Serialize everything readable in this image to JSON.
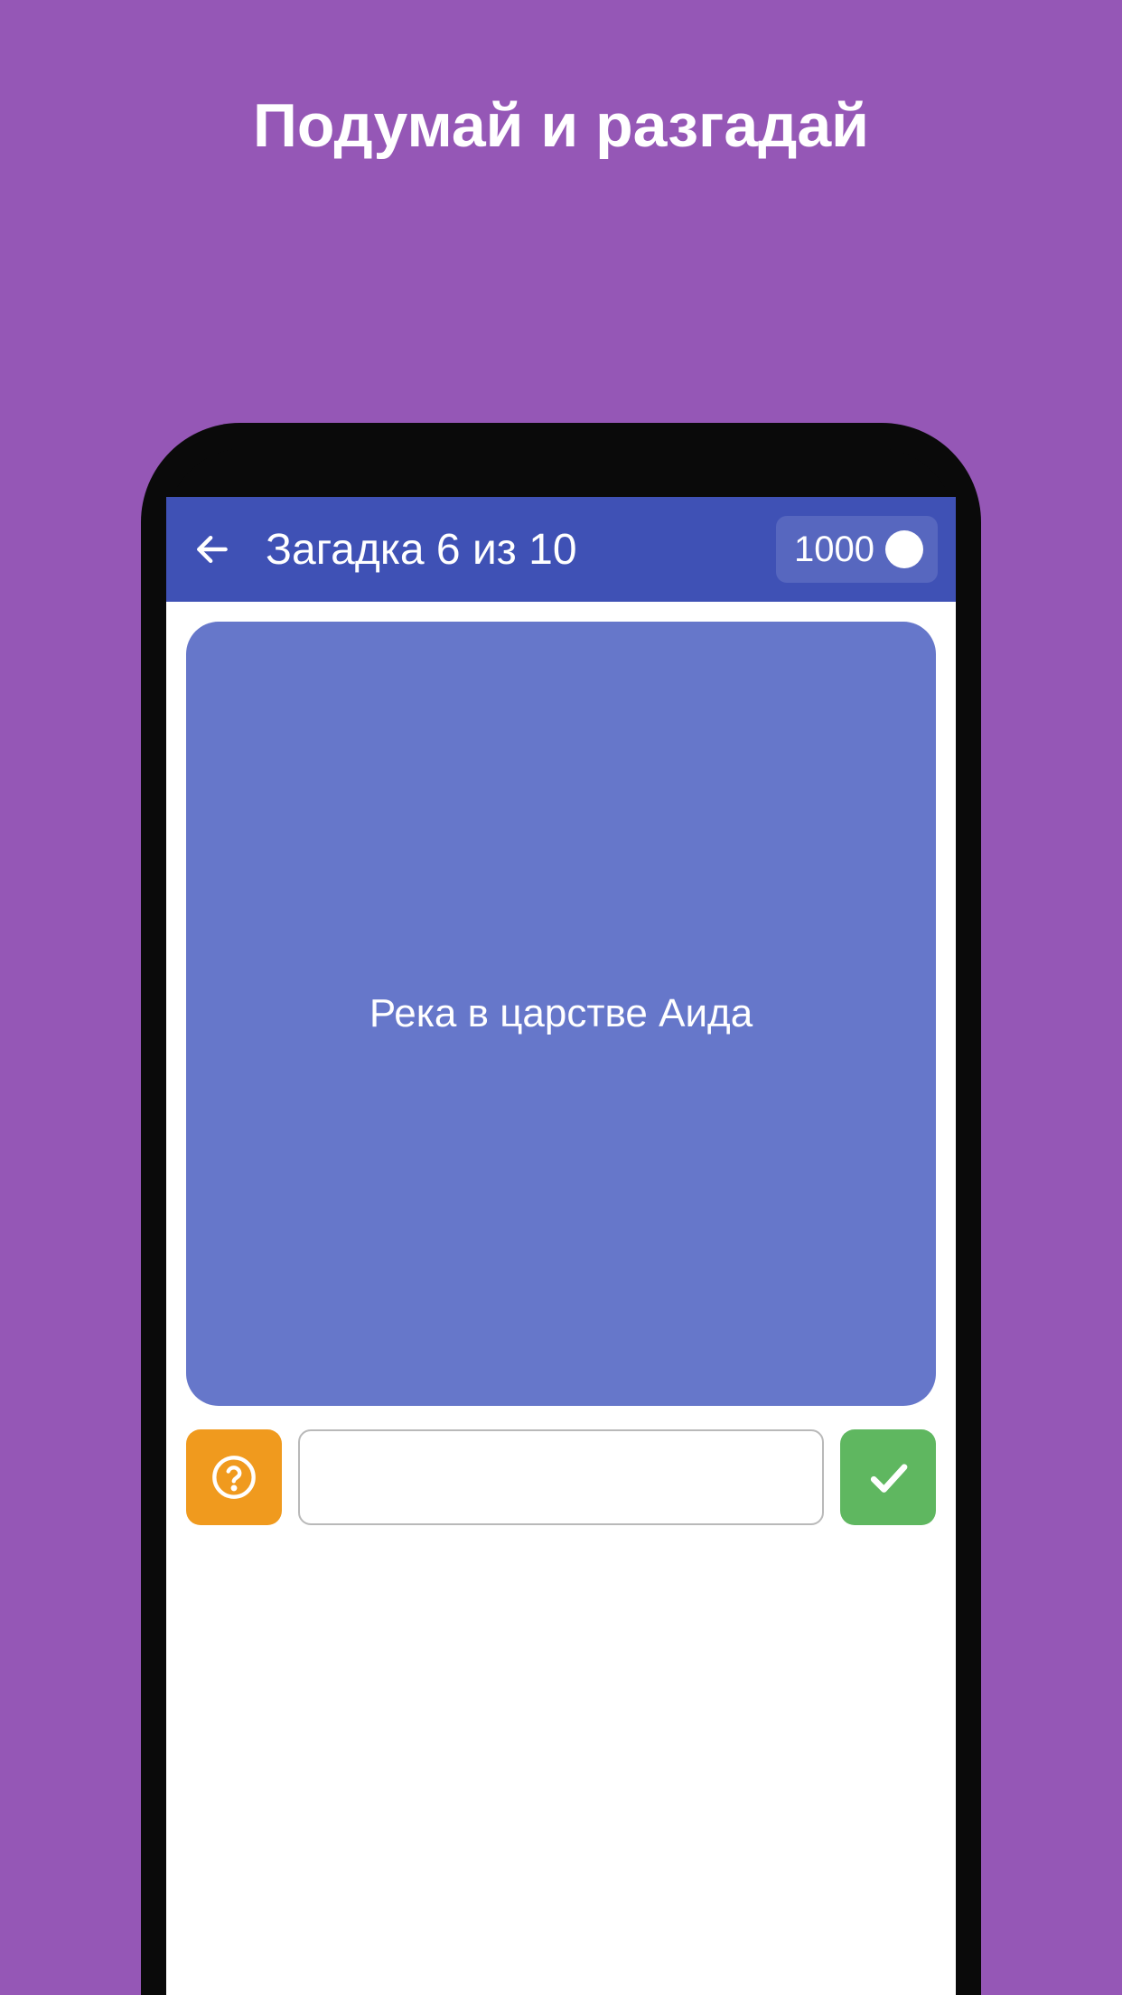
{
  "promo": {
    "title": "Подумай и разгадай"
  },
  "appbar": {
    "title": "Загадка 6 из 10",
    "coin_value": "1000"
  },
  "riddle": {
    "text": "Река в царстве Аида"
  },
  "input": {
    "value": "",
    "placeholder": ""
  }
}
